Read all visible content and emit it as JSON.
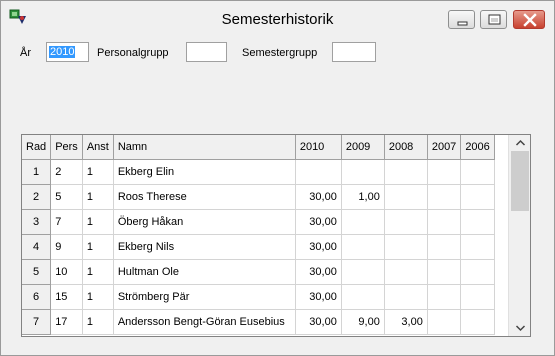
{
  "window": {
    "title": "Semesterhistorik",
    "icons": {
      "app": "app-icon",
      "minimize": "minimize-icon",
      "maximize": "maximize-icon",
      "close": "close-icon"
    }
  },
  "filters": {
    "year_label": "År",
    "year_value": "2010",
    "personalgrupp_label": "Personalgrupp",
    "personalgrupp_value": "",
    "semestergrupp_label": "Semestergrupp",
    "semestergrupp_value": ""
  },
  "table": {
    "headers": [
      "Rad",
      "Pers",
      "Anst",
      "Namn",
      "2010",
      "2009",
      "2008",
      "2007",
      "2006"
    ],
    "rows": [
      {
        "rad": "1",
        "pers": "2",
        "anst": "1",
        "namn": "Ekberg Elin",
        "y2010": "",
        "y2009": "",
        "y2008": "",
        "y2007": "",
        "y2006": ""
      },
      {
        "rad": "2",
        "pers": "5",
        "anst": "1",
        "namn": "Roos Therese",
        "y2010": "30,00",
        "y2009": "1,00",
        "y2008": "",
        "y2007": "",
        "y2006": ""
      },
      {
        "rad": "3",
        "pers": "7",
        "anst": "1",
        "namn": "Öberg Håkan",
        "y2010": "30,00",
        "y2009": "",
        "y2008": "",
        "y2007": "",
        "y2006": ""
      },
      {
        "rad": "4",
        "pers": "9",
        "anst": "1",
        "namn": "Ekberg Nils",
        "y2010": "30,00",
        "y2009": "",
        "y2008": "",
        "y2007": "",
        "y2006": ""
      },
      {
        "rad": "5",
        "pers": "10",
        "anst": "1",
        "namn": "Hultman Ole",
        "y2010": "30,00",
        "y2009": "",
        "y2008": "",
        "y2007": "",
        "y2006": ""
      },
      {
        "rad": "6",
        "pers": "15",
        "anst": "1",
        "namn": "Strömberg Pär",
        "y2010": "30,00",
        "y2009": "",
        "y2008": "",
        "y2007": "",
        "y2006": ""
      },
      {
        "rad": "7",
        "pers": "17",
        "anst": "1",
        "namn": "Andersson Bengt-Göran Eusebius",
        "y2010": "30,00",
        "y2009": "9,00",
        "y2008": "3,00",
        "y2007": "",
        "y2006": ""
      }
    ]
  },
  "scrollbar": {
    "up_icon": "chevron-up-icon",
    "down_icon": "chevron-down-icon"
  }
}
